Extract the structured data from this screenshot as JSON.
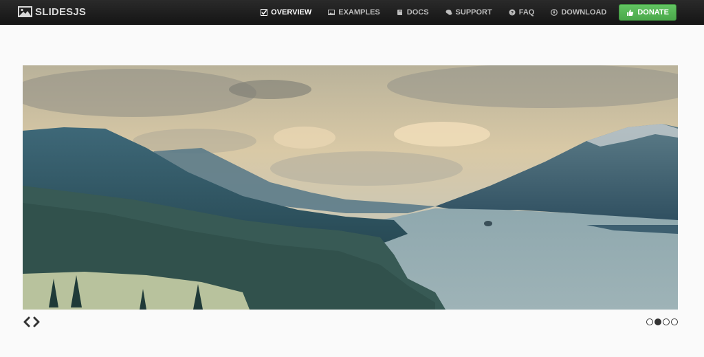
{
  "brand": {
    "name": "SLIDESJS"
  },
  "nav": {
    "items": [
      {
        "label": "OVERVIEW",
        "icon": "check-icon",
        "active": true
      },
      {
        "label": "EXAMPLES",
        "icon": "image-icon",
        "active": false
      },
      {
        "label": "DOCS",
        "icon": "book-icon",
        "active": false
      },
      {
        "label": "SUPPORT",
        "icon": "chat-icon",
        "active": false
      },
      {
        "label": "FAQ",
        "icon": "question-icon",
        "active": false
      },
      {
        "label": "DOWNLOAD",
        "icon": "download-icon",
        "active": false
      }
    ],
    "donate_label": "DONATE"
  },
  "slideshow": {
    "current_slide": 2,
    "total_slides": 4
  },
  "colors": {
    "navbar": "#1f1f1f",
    "donate": "#5bb75b",
    "background": "#fafafa"
  }
}
